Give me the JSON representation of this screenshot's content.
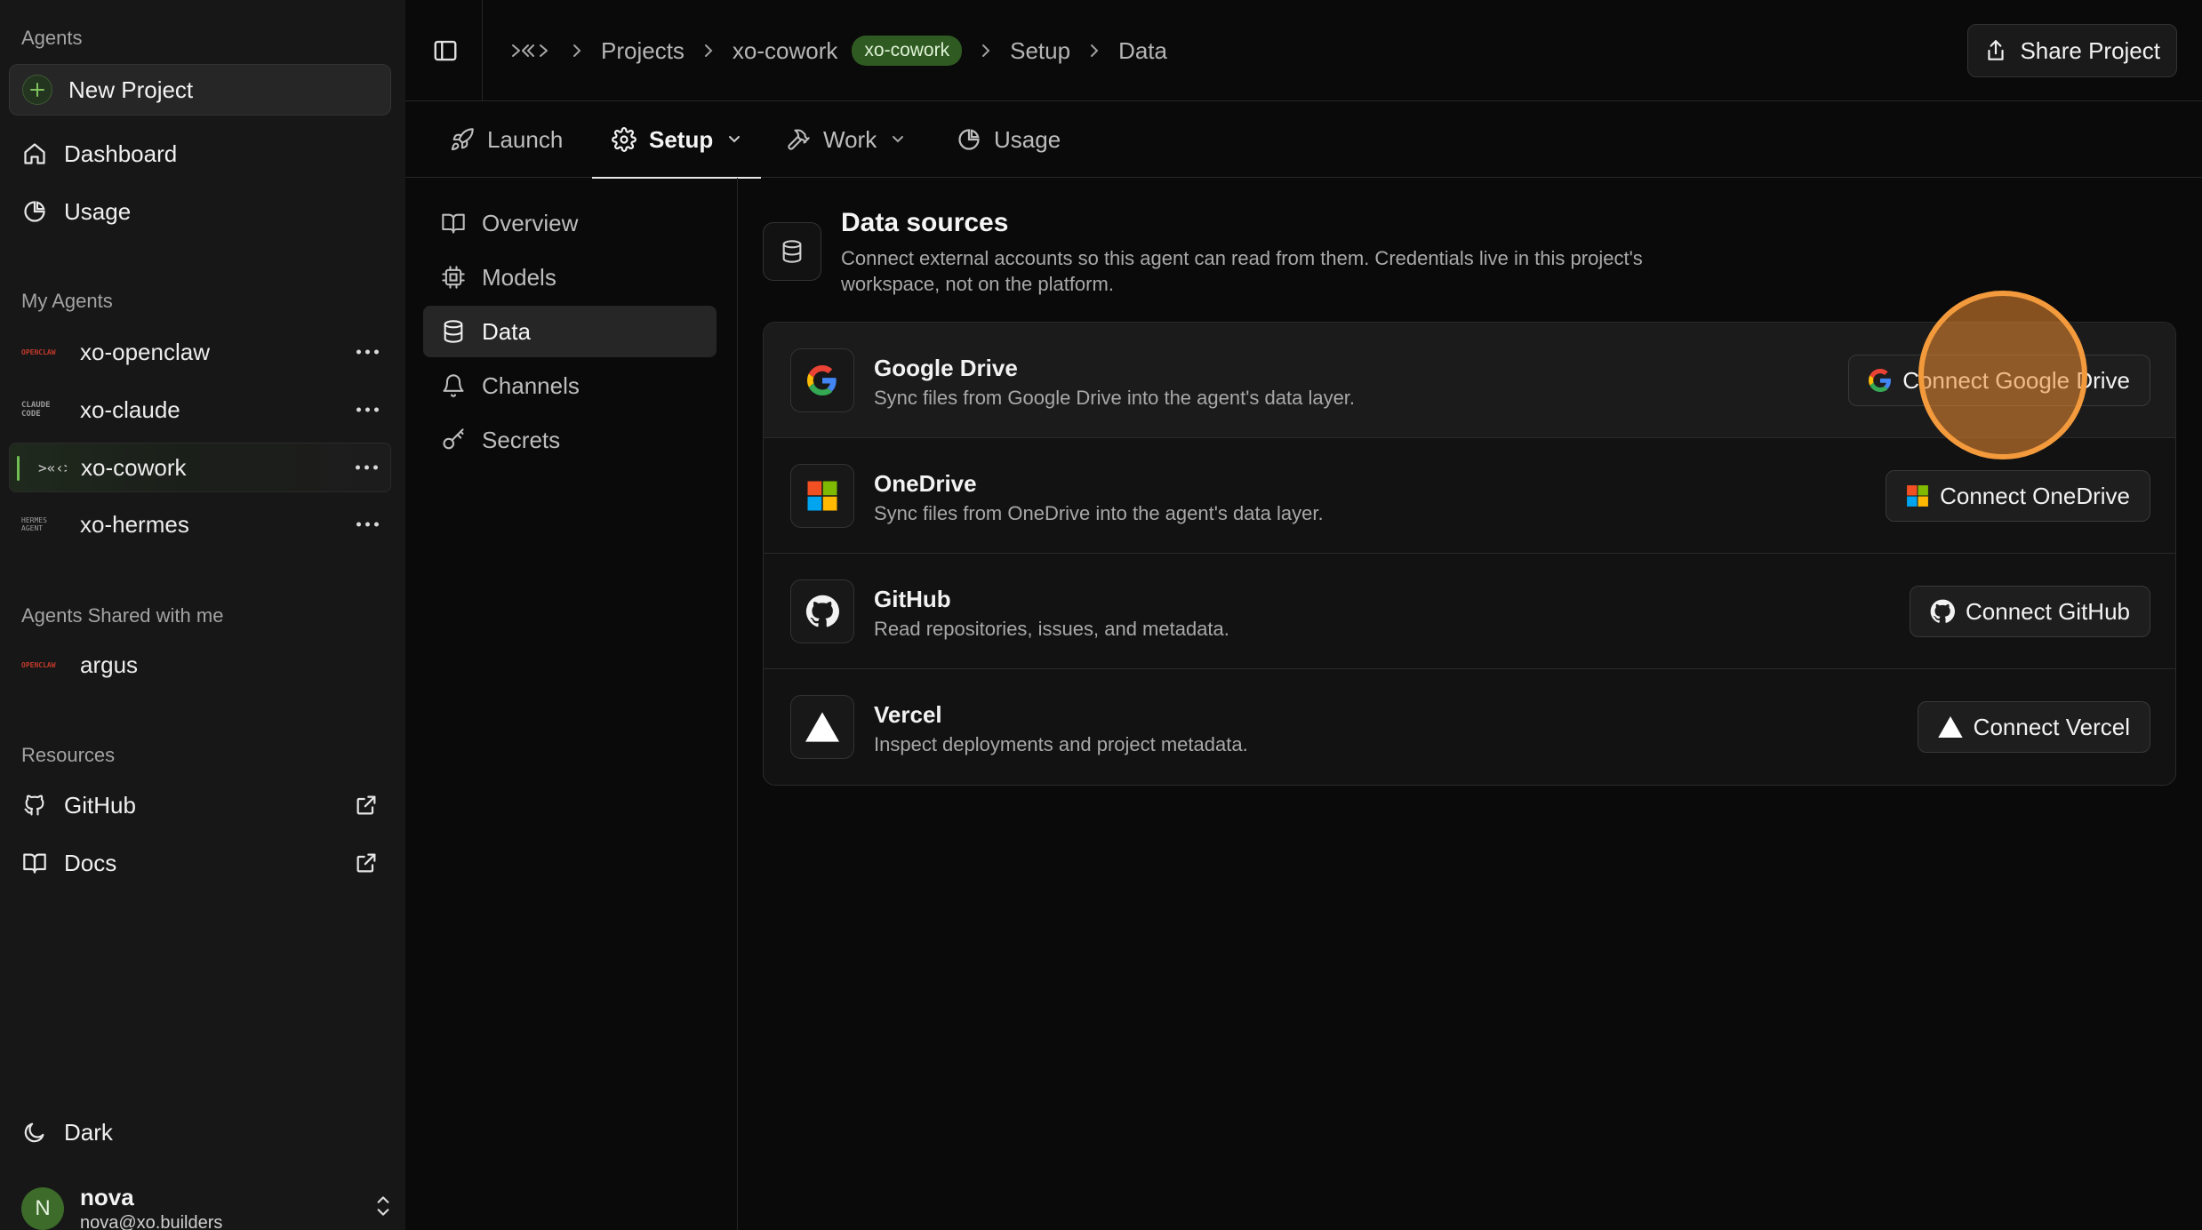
{
  "sidebar": {
    "agents_title": "Agents",
    "new_project": "New Project",
    "nav": [
      {
        "label": "Dashboard",
        "icon": "home-icon"
      },
      {
        "label": "Usage",
        "icon": "pie-chart-icon"
      }
    ],
    "my_agents_title": "My Agents",
    "my_agents": [
      {
        "name": "xo-openclaw",
        "logo_text": "OPENCLAW"
      },
      {
        "name": "xo-claude",
        "logo_text": "CLAUDE CODE"
      },
      {
        "name": "xo-cowork",
        "logo_text": ">«‹>",
        "active": true
      },
      {
        "name": "xo-hermes",
        "logo_text": "HERMES AGENT"
      }
    ],
    "shared_title": "Agents Shared with me",
    "shared_agents": [
      {
        "name": "argus",
        "logo_text": "OPENCLAW"
      }
    ],
    "resources_title": "Resources",
    "resources": [
      {
        "label": "GitHub",
        "icon": "github-icon"
      },
      {
        "label": "Docs",
        "icon": "book-icon"
      }
    ],
    "theme_label": "Dark",
    "user": {
      "initial": "N",
      "name": "nova",
      "email": "nova@xo.builders"
    }
  },
  "topbar": {
    "breadcrumbs": [
      "Projects",
      "xo-cowork",
      "Setup",
      "Data"
    ],
    "badge": "xo-cowork",
    "share_label": "Share Project"
  },
  "tabs": [
    {
      "label": "Launch",
      "icon": "rocket-icon"
    },
    {
      "label": "Setup",
      "icon": "gear-icon",
      "active": true,
      "dropdown": true
    },
    {
      "label": "Work",
      "icon": "hammer-icon",
      "dropdown": true
    },
    {
      "label": "Usage",
      "icon": "pie-chart-icon"
    }
  ],
  "subnav": [
    {
      "label": "Overview",
      "icon": "book-icon"
    },
    {
      "label": "Models",
      "icon": "chip-icon"
    },
    {
      "label": "Data",
      "icon": "database-icon",
      "active": true
    },
    {
      "label": "Channels",
      "icon": "bell-icon"
    },
    {
      "label": "Secrets",
      "icon": "key-icon"
    }
  ],
  "content": {
    "title": "Data sources",
    "description": "Connect external accounts so this agent can read from them. Credentials live in this project's workspace, not on the platform.",
    "sources": [
      {
        "name": "Google Drive",
        "description": "Sync files from Google Drive into the agent's data layer.",
        "button": "Connect Google Drive",
        "icon": "google-icon"
      },
      {
        "name": "OneDrive",
        "description": "Sync files from OneDrive into the agent's data layer.",
        "button": "Connect OneDrive",
        "icon": "microsoft-icon"
      },
      {
        "name": "GitHub",
        "description": "Read repositories, issues, and metadata.",
        "button": "Connect GitHub",
        "icon": "github-icon"
      },
      {
        "name": "Vercel",
        "description": "Inspect deployments and project metadata.",
        "button": "Connect Vercel",
        "icon": "vercel-triangle-icon"
      }
    ]
  },
  "colors": {
    "background": "#0a0a0a",
    "sidebar": "#171717",
    "accent_green": "#2f5a22",
    "cursor_highlight": "#f39a3c"
  }
}
